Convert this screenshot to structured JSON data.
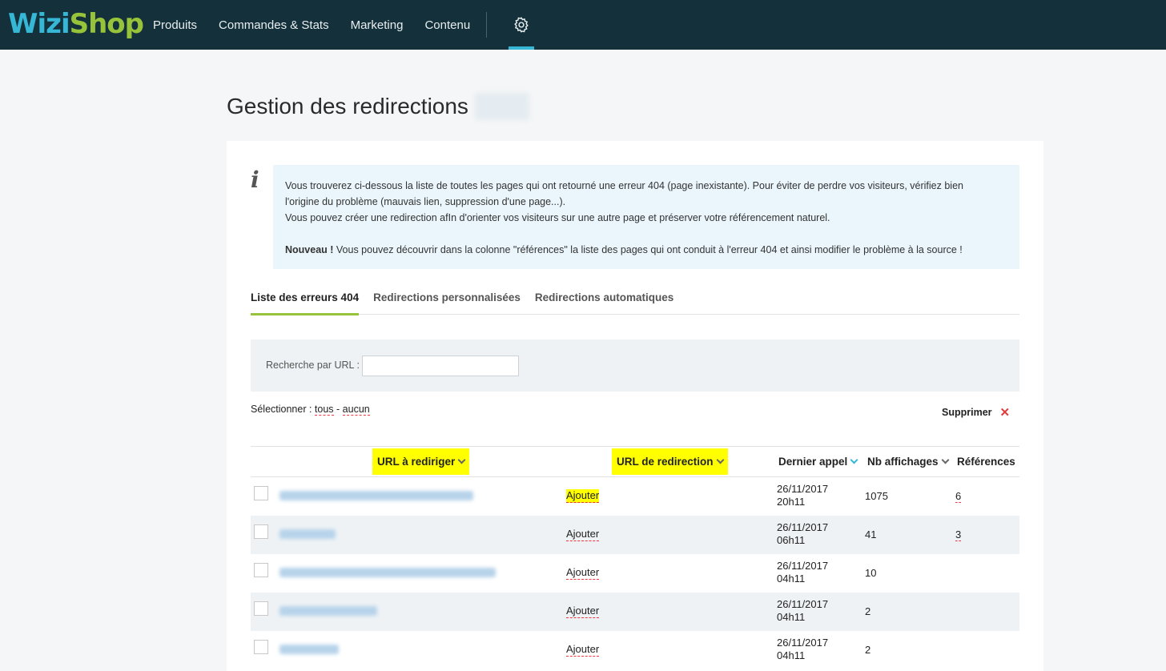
{
  "brand": {
    "part1": "Wizi",
    "part2": "Shop"
  },
  "nav": {
    "items": [
      "Produits",
      "Commandes & Stats",
      "Marketing",
      "Contenu"
    ]
  },
  "page": {
    "title": "Gestion des redirections"
  },
  "info": {
    "line1": "Vous trouverez ci-dessous la liste de toutes les pages qui ont retourné une erreur 404 (page inexistante). Pour éviter de perdre vos visiteurs, vérifiez bien",
    "line2": "l'origine du problème (mauvais lien, suppression d'une page...).",
    "line3": "Vous pouvez créer une redirection afIn d'orienter vos visiteurs sur une autre page et préserver votre référencement naturel.",
    "new_label": "Nouveau !",
    "line4": " Vous pouvez découvrir dans la colonne \"références\" la liste des pages qui ont conduit à l'erreur 404 et ainsi modifier le problème à la source !"
  },
  "tabs": [
    "Liste des erreurs 404",
    "Redirections personnalisées",
    "Redirections automatiques"
  ],
  "search": {
    "label": "Recherche par URL :",
    "value": ""
  },
  "select": {
    "label": "Sélectionner : ",
    "all": "tous",
    "sep": " - ",
    "none": "aucun"
  },
  "delete_label": "Supprimer",
  "table": {
    "headers": {
      "url": "URL à rediriger",
      "redirect": "URL de redirection",
      "last_call": "Dernier appel",
      "views": "Nb affichages",
      "refs": "Références"
    },
    "rows": [
      {
        "add": "Ajouter",
        "date": "26/11/2017",
        "time": "20h11",
        "views": "1075",
        "refs": "6"
      },
      {
        "add": "Ajouter",
        "date": "26/11/2017",
        "time": "06h11",
        "views": "41",
        "refs": "3"
      },
      {
        "add": "Ajouter",
        "date": "26/11/2017",
        "time": "04h11",
        "views": "10",
        "refs": ""
      },
      {
        "add": "Ajouter",
        "date": "26/11/2017",
        "time": "04h11",
        "views": "2",
        "refs": ""
      },
      {
        "add": "Ajouter",
        "date": "26/11/2017",
        "time": "04h11",
        "views": "2",
        "refs": ""
      }
    ]
  }
}
